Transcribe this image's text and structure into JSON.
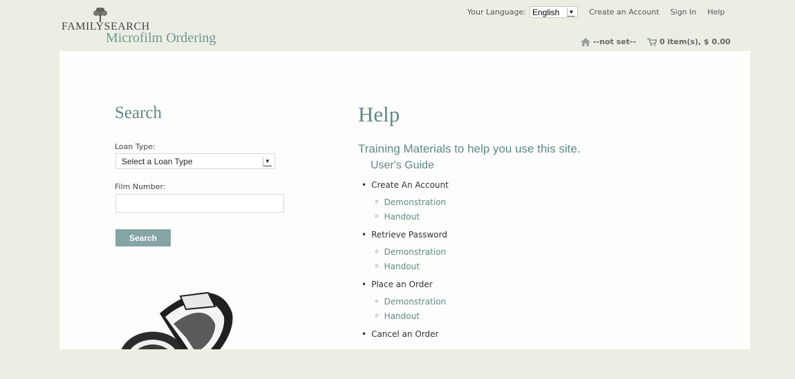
{
  "brand": {
    "name": "FamilySearch",
    "app_title": "Microfilm Ordering"
  },
  "topnav": {
    "language_label": "Your Language:",
    "language_value": "English",
    "links": [
      "Create an Account",
      "Sign In",
      "Help"
    ]
  },
  "status": {
    "location": "--not set--",
    "cart": "0 item(s), $ 0.00"
  },
  "search": {
    "heading": "Search",
    "loan_type_label": "Loan Type:",
    "loan_type_value": "Select a Loan Type",
    "film_number_label": "Film Number:",
    "film_number_value": "",
    "button_label": "Search"
  },
  "help": {
    "heading": "Help",
    "subheading": "Training Materials to help you use this site.",
    "guide": "User's Guide",
    "topics": [
      {
        "name": "Create An Account",
        "links": [
          "Demonstration",
          "Handout"
        ]
      },
      {
        "name": "Retrieve Password",
        "links": [
          "Demonstration",
          "Handout"
        ]
      },
      {
        "name": "Place an Order",
        "links": [
          "Demonstration",
          "Handout"
        ]
      },
      {
        "name": "Cancel an Order",
        "links": []
      }
    ]
  },
  "colors": {
    "accent": "#5d8a87",
    "button": "#85a4a4",
    "background": "#eceee4",
    "panel": "#fdfdfc"
  },
  "icons": [
    "family-tree-icon",
    "home-icon",
    "cart-icon",
    "chevron-down-icon",
    "film-reel-icon"
  ]
}
